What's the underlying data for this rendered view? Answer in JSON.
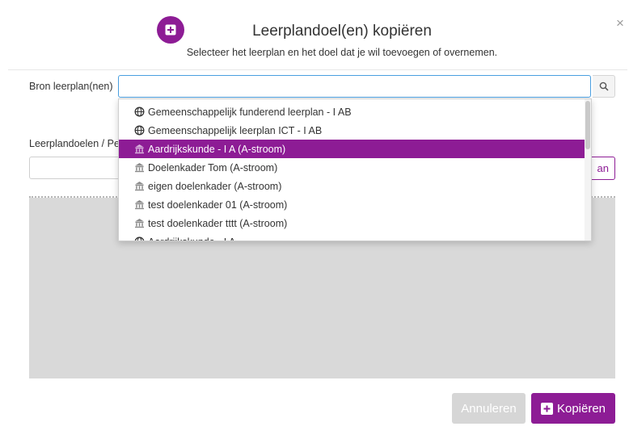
{
  "dialog": {
    "title": "Leerplandoel(en) kopiëren",
    "subtitle": "Selecteer het leerplan en het doel dat je wil toevoegen of overnemen.",
    "close_label": "×",
    "accent_color": "#8d1c95"
  },
  "bron": {
    "label": "Bron leerplan(nen)",
    "value": "",
    "placeholder": ""
  },
  "leerplandoelen": {
    "label": "Leerplandoelen / Pe",
    "side_button_label": "an"
  },
  "dropdown": {
    "items": [
      {
        "label": "Gemeenschappelijk funderend leerplan - I AB",
        "icon": "globe-icon",
        "selected": false
      },
      {
        "label": "Gemeenschappelijk leerplan ICT - I AB",
        "icon": "globe-icon",
        "selected": false
      },
      {
        "label": "Aardrijkskunde - I A (A-stroom)",
        "icon": "school-icon",
        "selected": true
      },
      {
        "label": "Doelenkader Tom (A-stroom)",
        "icon": "school-icon",
        "selected": false
      },
      {
        "label": "eigen doelenkader (A-stroom)",
        "icon": "school-icon",
        "selected": false
      },
      {
        "label": "test doelenkader 01 (A-stroom)",
        "icon": "school-icon",
        "selected": false
      },
      {
        "label": "test doelenkader tttt (A-stroom)",
        "icon": "school-icon",
        "selected": false
      },
      {
        "label": "Aardrijkskunde - I A",
        "icon": "globe-icon",
        "selected": false
      }
    ]
  },
  "footer": {
    "cancel_label": "Annuleren",
    "copy_label": "Kopiëren"
  }
}
